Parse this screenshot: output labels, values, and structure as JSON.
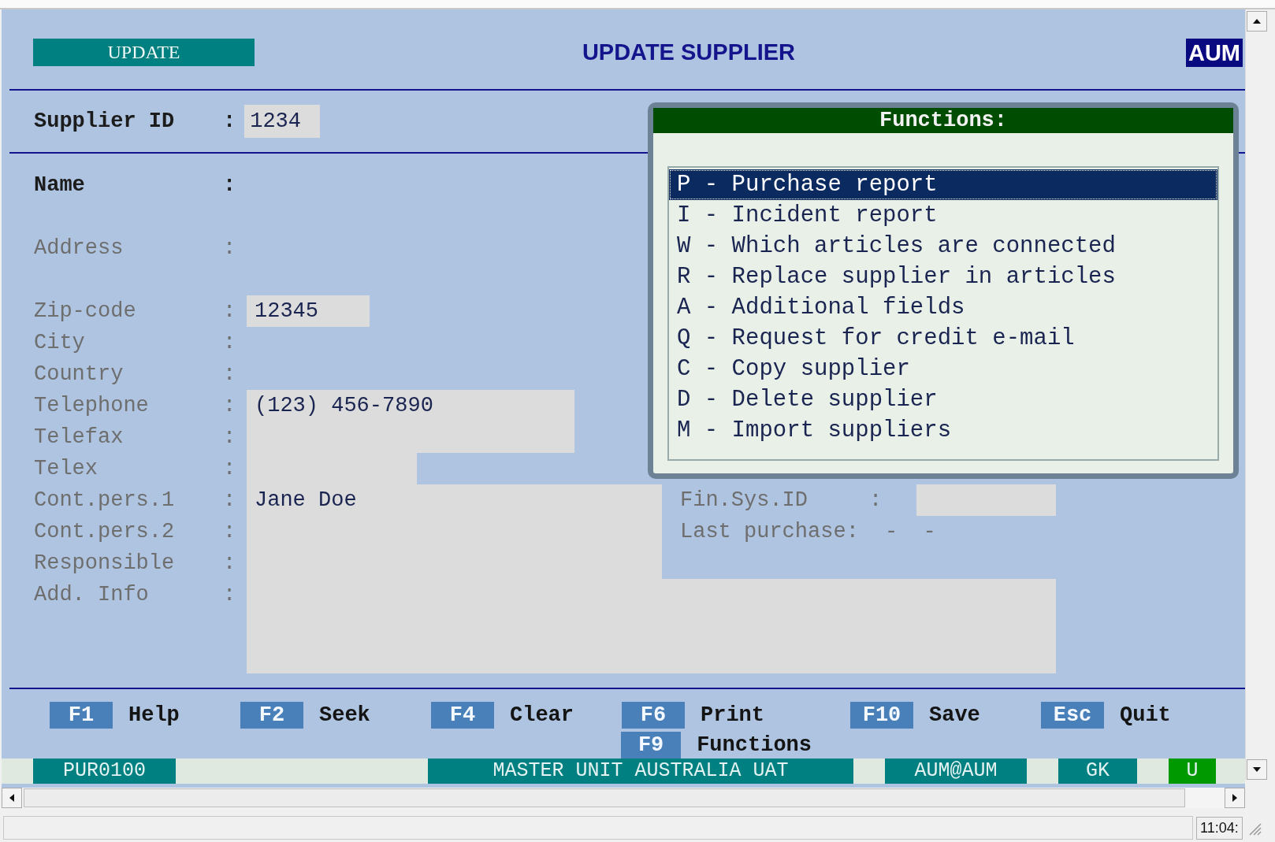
{
  "mode_badge": "UPDATE",
  "title": "UPDATE SUPPLIER",
  "company_badge": "AUM",
  "supplier_id": {
    "label": "Supplier ID",
    "colon": ":",
    "value": "1234"
  },
  "fields": [
    {
      "label": "Name",
      "colon": ":",
      "active": true
    },
    {
      "label": "Address",
      "colon": ":",
      "active": false
    },
    {
      "label": "Zip-code",
      "colon": ":",
      "active": false,
      "value": "12345"
    },
    {
      "label": "City",
      "colon": ":",
      "active": false
    },
    {
      "label": "Country",
      "colon": ":",
      "active": false
    },
    {
      "label": "Telephone",
      "colon": ":",
      "active": false,
      "value": "(123) 456-7890"
    },
    {
      "label": "Telefax",
      "colon": ":",
      "active": false
    },
    {
      "label": "Telex",
      "colon": ":",
      "active": false
    },
    {
      "label": "Cont.pers.1",
      "colon": ":",
      "active": false,
      "value": "Jane Doe"
    },
    {
      "label": "Cont.pers.2",
      "colon": ":",
      "active": false
    },
    {
      "label": "Responsible",
      "colon": ":",
      "active": false
    },
    {
      "label": "Add. Info",
      "colon": ":",
      "active": false
    }
  ],
  "side_fields": [
    {
      "label": "Fin.Sys.ID",
      "colon": ":",
      "kind": "input"
    },
    {
      "label": "Last purchase:",
      "value": "-  -",
      "kind": "text"
    }
  ],
  "functions_popup": {
    "title": "Functions:",
    "items": [
      {
        "text": "P - Purchase report",
        "selected": true
      },
      {
        "text": "I - Incident report",
        "selected": false
      },
      {
        "text": "W - Which articles are connected",
        "selected": false
      },
      {
        "text": "R - Replace supplier in articles",
        "selected": false
      },
      {
        "text": "A - Additional fields",
        "selected": false
      },
      {
        "text": "Q - Request for credit e-mail",
        "selected": false
      },
      {
        "text": "C - Copy supplier",
        "selected": false
      },
      {
        "text": "D - Delete supplier",
        "selected": false
      },
      {
        "text": "M - Import suppliers",
        "selected": false
      }
    ]
  },
  "function_keys": [
    [
      {
        "key": "F1",
        "label": "Help"
      },
      {
        "key": "F2",
        "label": "Seek"
      },
      {
        "key": "F4",
        "label": "Clear"
      },
      {
        "key": "F6",
        "label": "Print"
      },
      {
        "key": "F10",
        "label": "Save"
      },
      {
        "key": "Esc",
        "label": "Quit"
      }
    ],
    [
      {
        "key": "F9",
        "label": "Functions"
      }
    ]
  ],
  "status_segments": [
    {
      "text": "PUR0100",
      "color": "#008080"
    },
    {
      "text": "MASTER UNIT AUSTRALIA UAT",
      "color": "#008080"
    },
    {
      "text": "AUM@AUM",
      "color": "#008080"
    },
    {
      "text": "GK",
      "color": "#008080"
    },
    {
      "text": "U",
      "color": "#009900"
    }
  ],
  "status_bar": {
    "time": "11:04:"
  }
}
